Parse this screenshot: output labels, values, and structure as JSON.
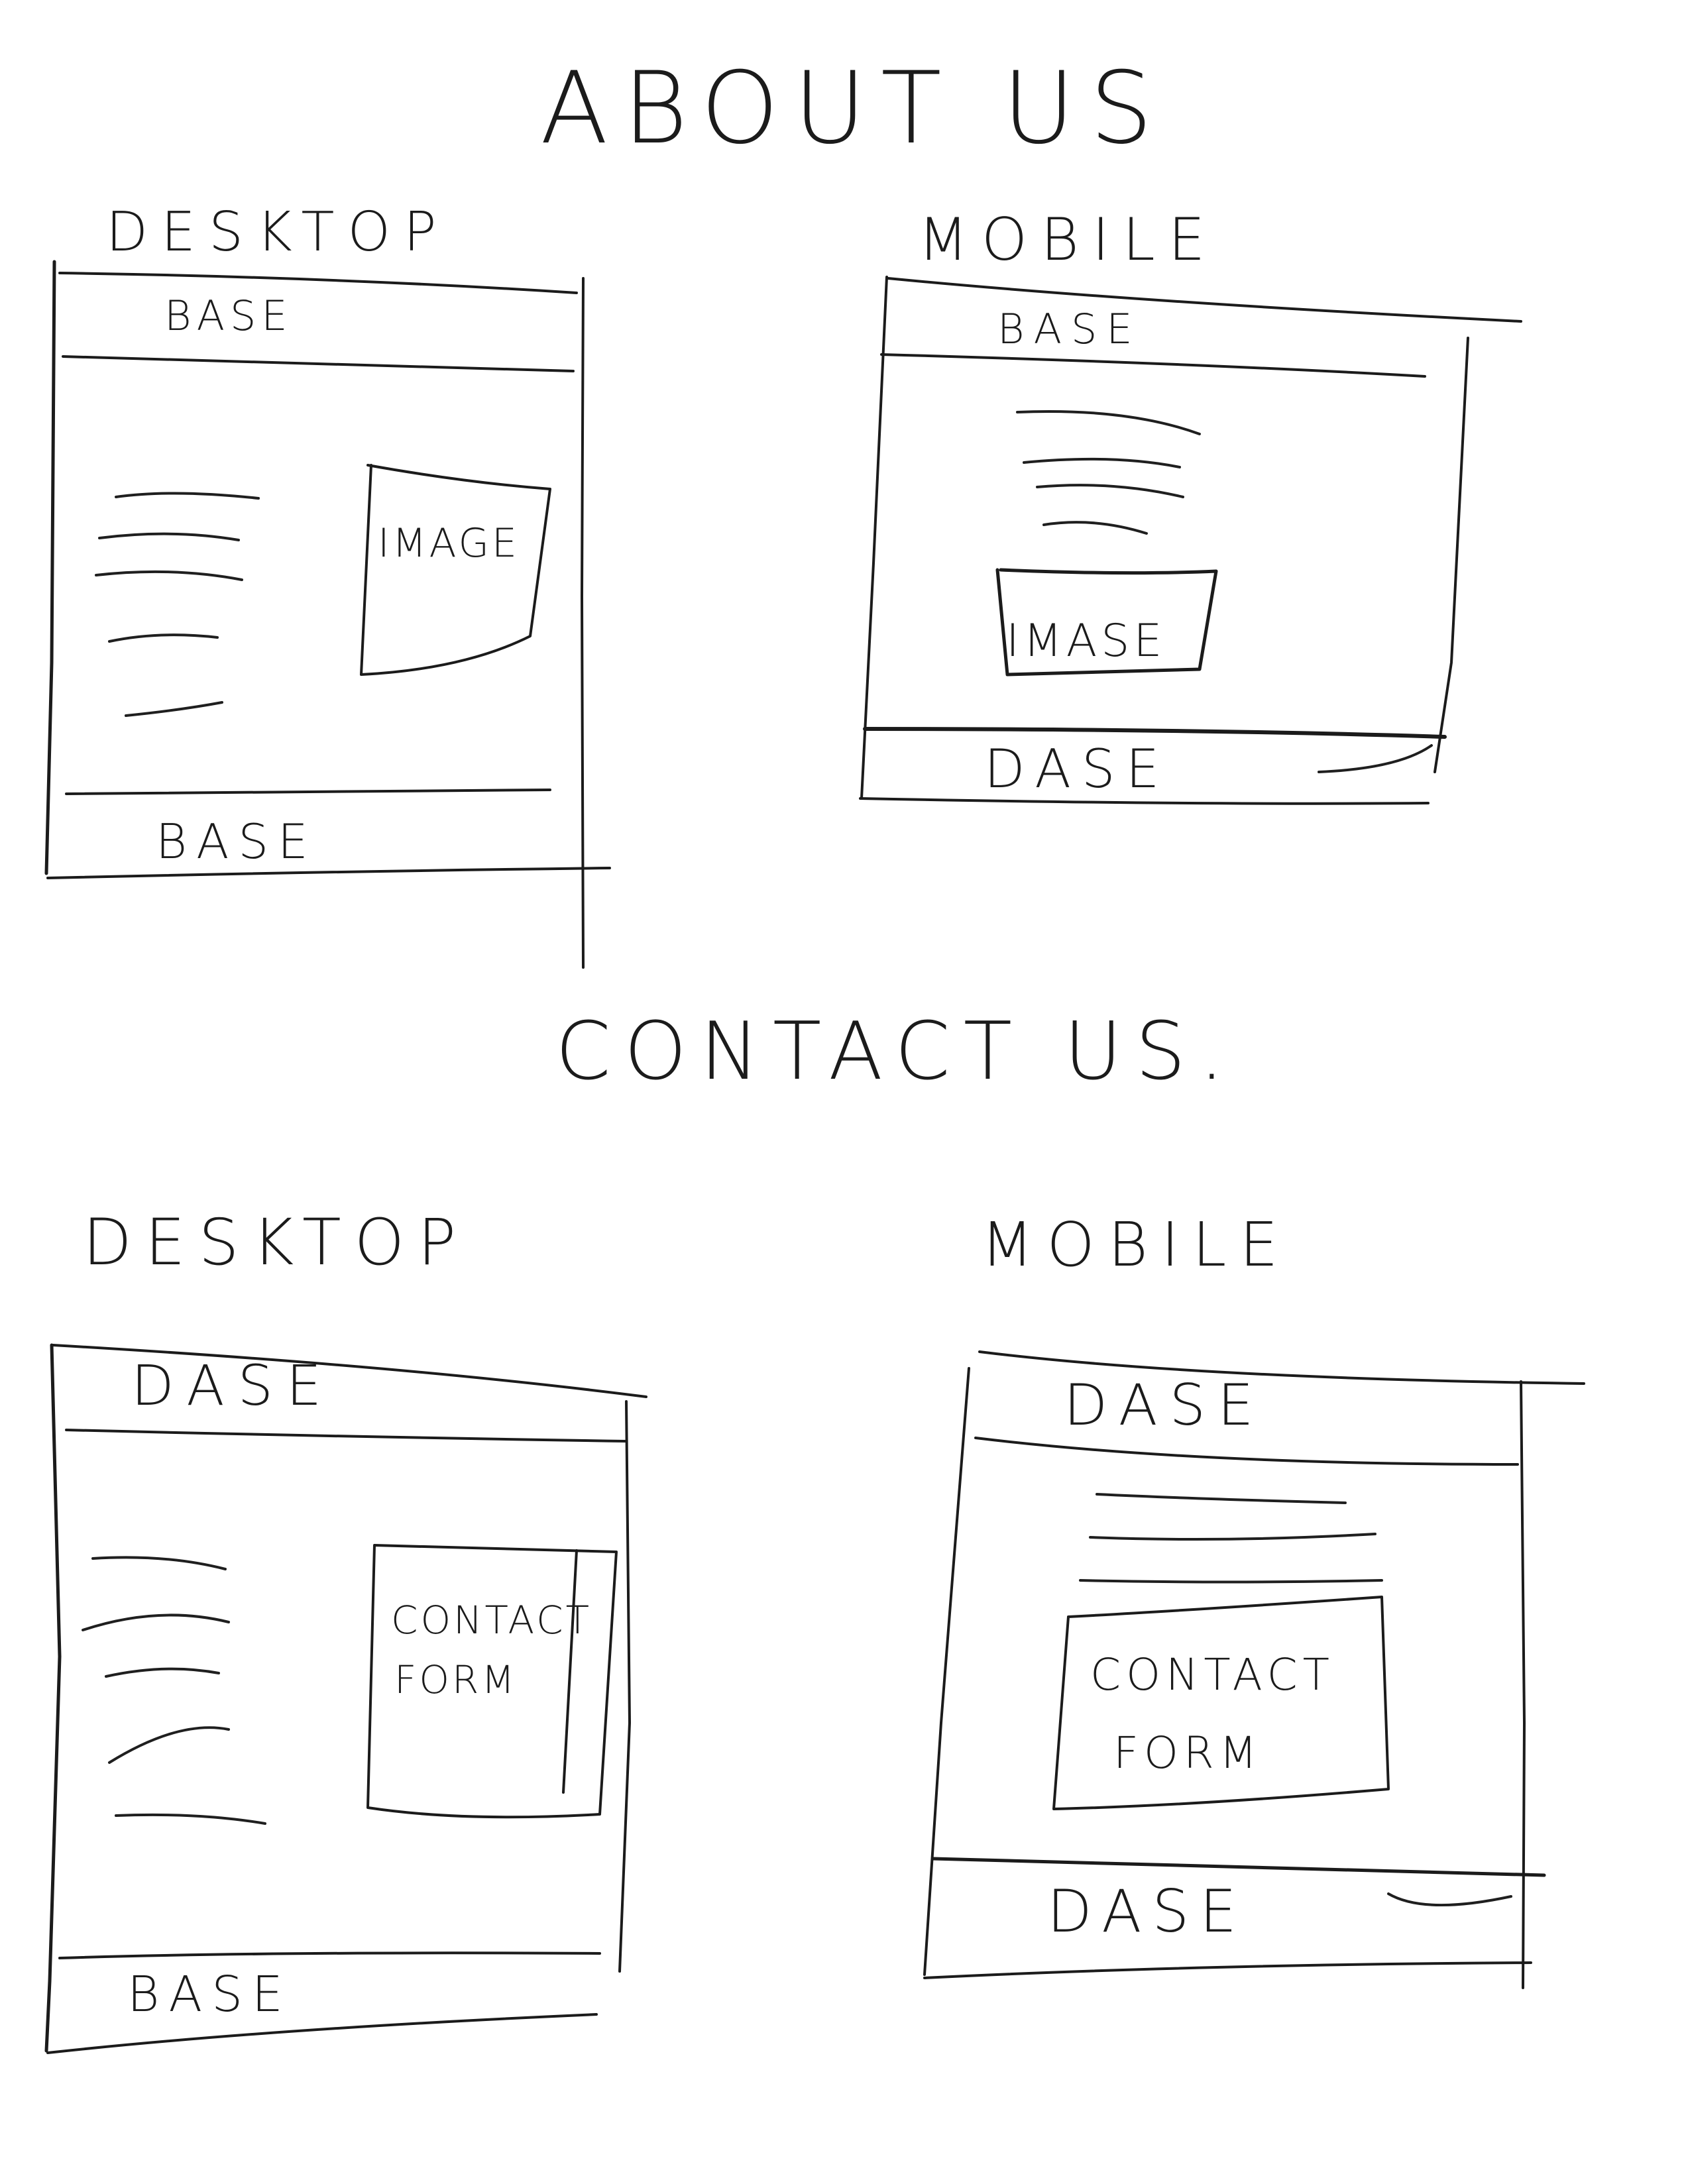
{
  "sections": [
    {
      "title": "ABOUT US",
      "desktop": {
        "label": "DESKTOP",
        "header": "BASE",
        "content_box": "IMAGE",
        "footer": "BASE"
      },
      "mobile": {
        "label": "MOBILE",
        "header": "BASE",
        "content_box": "IMASE",
        "footer": "DASE"
      }
    },
    {
      "title": "CONTACT US.",
      "desktop": {
        "label": "DESKTOP",
        "header": "DASE",
        "content_box_line1": "CONTACT",
        "content_box_line2": "FORM",
        "footer": "BASE"
      },
      "mobile": {
        "label": "MOBILE",
        "header": "DASE",
        "content_box_line1": "CONTACT",
        "content_box_line2": "FORM",
        "footer": "DASE"
      }
    }
  ],
  "ink_color": "#1b1b1b"
}
